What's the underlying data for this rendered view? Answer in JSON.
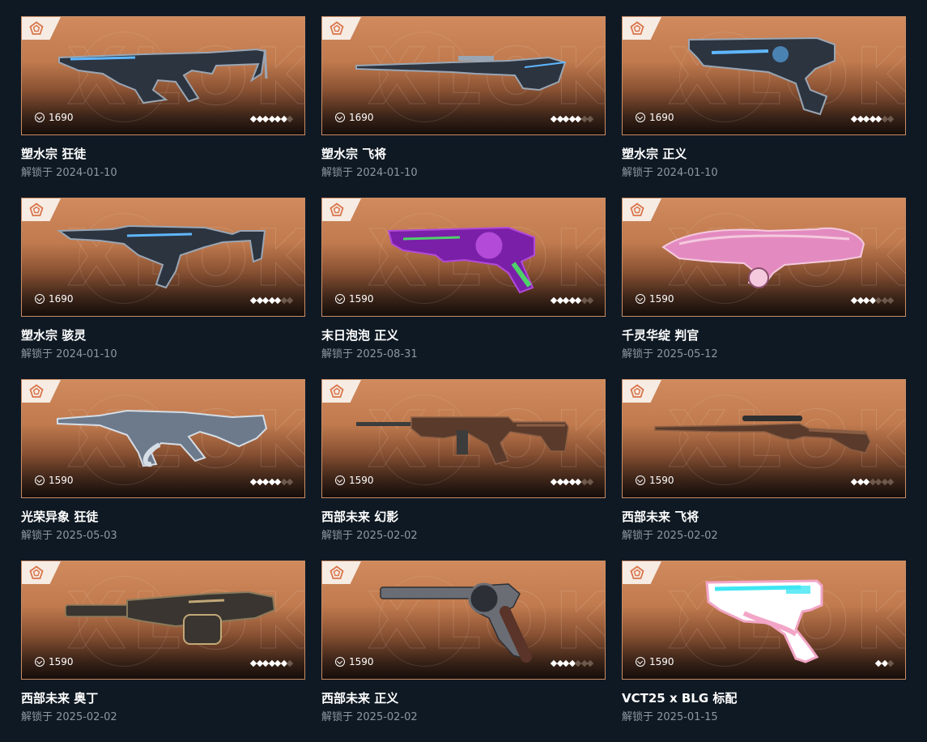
{
  "unlock_prefix": "解锁于",
  "colors": {
    "background": "#0f1923",
    "card_border": "#c98d66",
    "card_top": "#d08a5d",
    "text": "#ffffff",
    "muted": "#8e98a3"
  },
  "watermark_text": "XLOK",
  "items": [
    {
      "name": "塑水宗 狂徒",
      "date": "解锁于 2024-01-10",
      "price": "1690",
      "rating": 6,
      "rating_max": 7,
      "gun": "rifle-vandal",
      "palette": [
        "#2c3440",
        "#9aa6b4",
        "#5fb7ff"
      ]
    },
    {
      "name": "塑水宗 飞将",
      "date": "解锁于 2024-01-10",
      "price": "1690",
      "rating": 5,
      "rating_max": 7,
      "gun": "sniper",
      "palette": [
        "#2c3440",
        "#9aa6b4",
        "#5fb7ff"
      ]
    },
    {
      "name": "塑水宗 正义",
      "date": "解锁于 2024-01-10",
      "price": "1690",
      "rating": 5,
      "rating_max": 7,
      "gun": "pistol-sheriff",
      "palette": [
        "#2c3440",
        "#9aa6b4",
        "#5fb7ff"
      ]
    },
    {
      "name": "塑水宗 骇灵",
      "date": "解锁于 2024-01-10",
      "price": "1690",
      "rating": 5,
      "rating_max": 7,
      "gun": "rifle-phantom",
      "palette": [
        "#2c3440",
        "#9aa6b4",
        "#5fb7ff"
      ]
    },
    {
      "name": "末日泡泡 正义",
      "date": "解锁于 2025-08-31",
      "price": "1590",
      "rating": 5,
      "rating_max": 7,
      "gun": "revolver",
      "palette": [
        "#7a1fa8",
        "#b34ad8",
        "#4fd16a"
      ]
    },
    {
      "name": "千灵华绽 判官",
      "date": "解锁于 2025-05-12",
      "price": "1590",
      "rating": 4,
      "rating_max": 7,
      "gun": "shotgun",
      "palette": [
        "#e38bc0",
        "#f5c9de",
        "#8a4f6d"
      ]
    },
    {
      "name": "光荣异象 狂徒",
      "date": "解锁于 2025-05-03",
      "price": "1590",
      "rating": 5,
      "rating_max": 7,
      "gun": "rifle-ornate",
      "palette": [
        "#6c7a8c",
        "#d5dde6",
        "#2e3440"
      ]
    },
    {
      "name": "西部未来 幻影",
      "date": "解锁于 2025-02-02",
      "price": "1590",
      "rating": 5,
      "rating_max": 7,
      "gun": "rifle-wood",
      "palette": [
        "#5a3a2a",
        "#8a5e44",
        "#3c3c3c"
      ]
    },
    {
      "name": "西部未来 飞将",
      "date": "解锁于 2025-02-02",
      "price": "1590",
      "rating": 3,
      "rating_max": 7,
      "gun": "sniper-wood",
      "palette": [
        "#5a3a2a",
        "#8a5e44",
        "#2f2f2f"
      ]
    },
    {
      "name": "西部未来 奥丁",
      "date": "解锁于 2025-02-02",
      "price": "1590",
      "rating": 6,
      "rating_max": 7,
      "gun": "minigun",
      "palette": [
        "#3a3530",
        "#8a7a5c",
        "#c2a878"
      ]
    },
    {
      "name": "西部未来 正义",
      "date": "解锁于 2025-02-02",
      "price": "1590",
      "rating": 4,
      "rating_max": 7,
      "gun": "revolver-wood",
      "palette": [
        "#6a6d74",
        "#2c2f35",
        "#5a3428"
      ]
    },
    {
      "name": "VCT25 x BLG 标配",
      "date": "解锁于 2025-01-15",
      "price": "1590",
      "rating": 2,
      "rating_max": 3,
      "gun": "pistol-classic",
      "palette": [
        "#f2a5c6",
        "#ffffff",
        "#3fe6f2"
      ]
    }
  ]
}
